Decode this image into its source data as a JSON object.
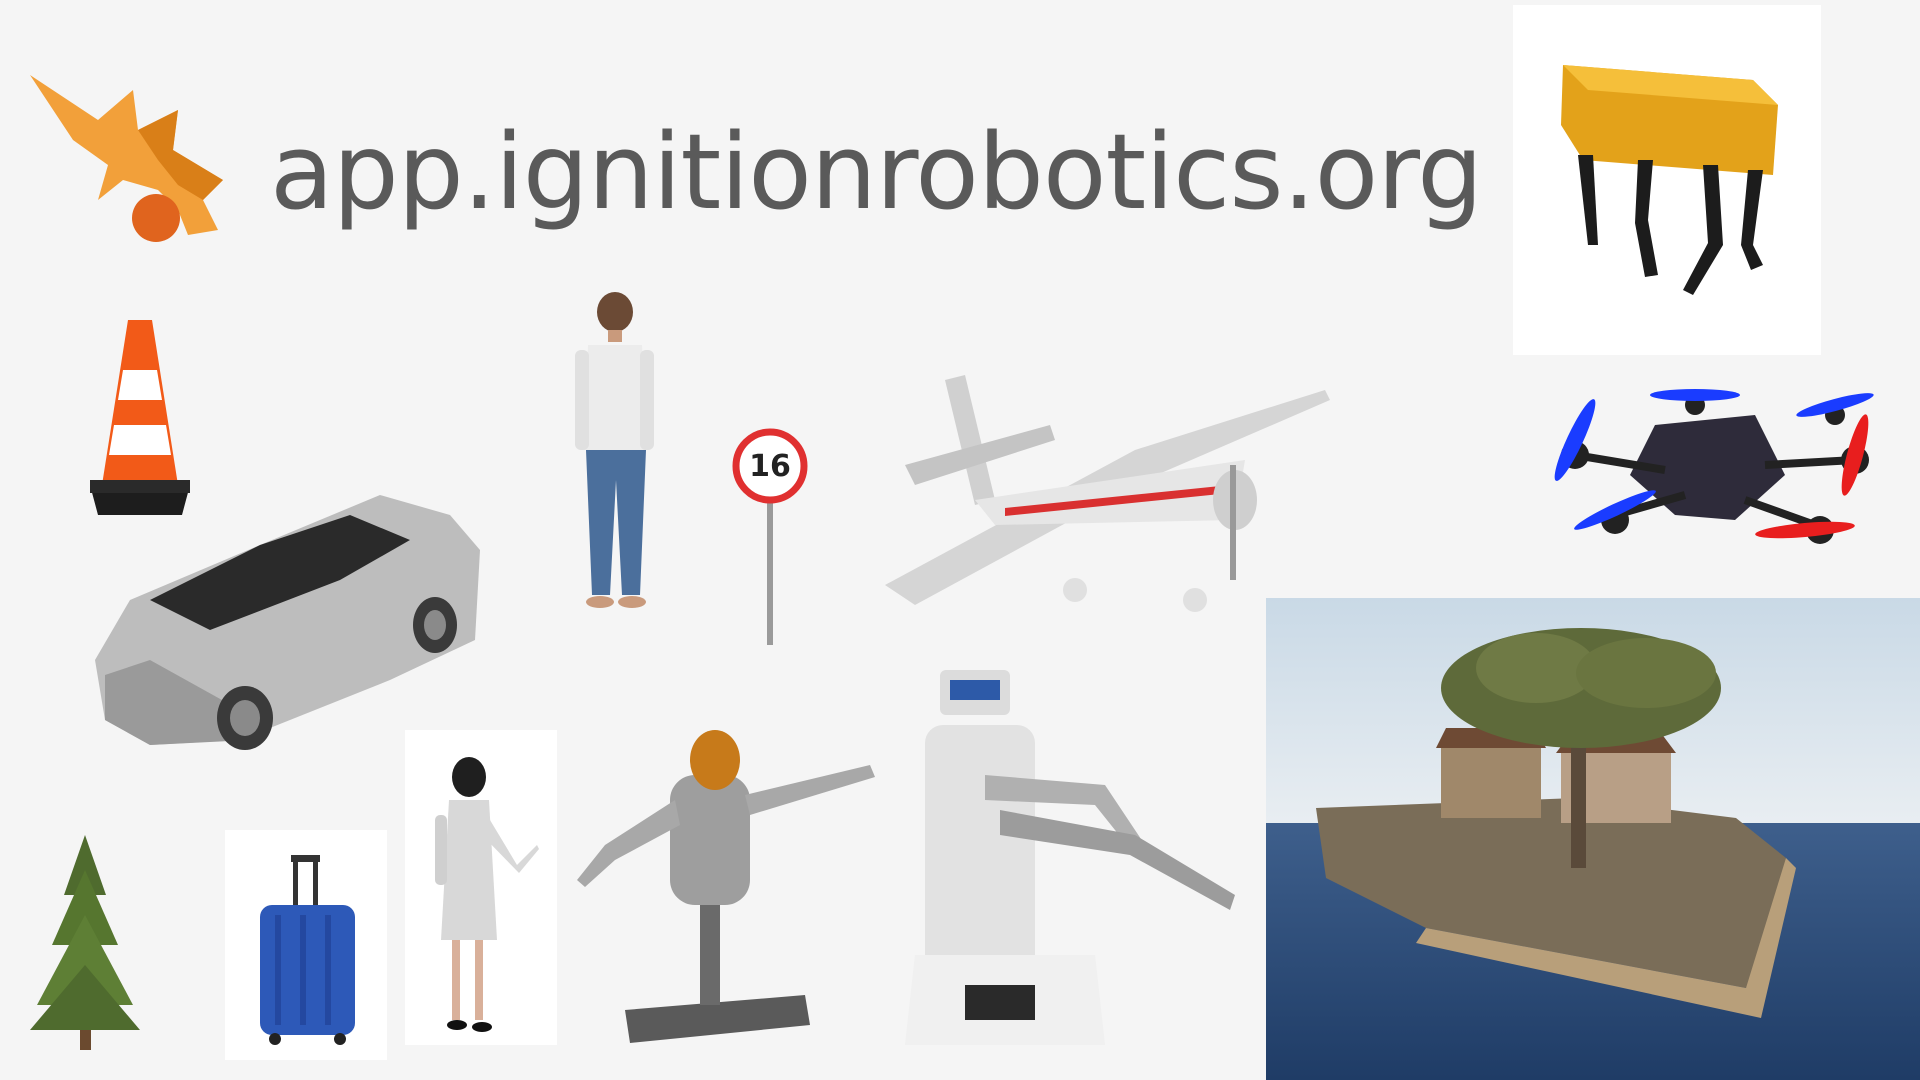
{
  "brand": {
    "url_text": "app.ignitionrobotics.org",
    "logo_icon": "ignition-flame-logo-icon",
    "colors": {
      "flame": "#f2a03a",
      "ball": "#e0641e",
      "text": "#5a5a5a"
    }
  },
  "models": [
    "traffic-cone-icon",
    "car-icon",
    "standing-person-icon",
    "speed-sign-icon",
    "airplane-icon",
    "quadruped-robot-icon",
    "hexacopter-drone-icon",
    "pine-tree-icon",
    "suitcase-icon",
    "nurse-icon",
    "humanoid-robot-icon",
    "mobile-manipulator-robot-icon",
    "island-scene-icon"
  ],
  "speed_sign": {
    "value": "16"
  }
}
